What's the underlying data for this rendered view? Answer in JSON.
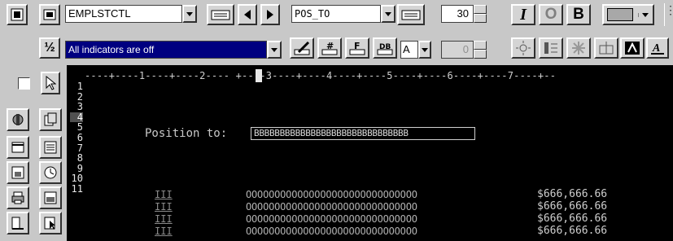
{
  "toolbar": {
    "record_format": {
      "value": "EMPLSTCTL"
    },
    "field_name": {
      "value": "POS_TO"
    },
    "length": {
      "value": "30"
    },
    "decimals": {
      "value": "0"
    },
    "indicators": {
      "value": "All indicators are off"
    },
    "format_a": {
      "value": "A"
    },
    "style_buttons": {
      "italic": "I",
      "outline": "O",
      "bold": "B"
    },
    "fraction_icon": "½"
  },
  "editor": {
    "ruler": "----+----1----+----2---- +----3----+----4----+----5----+----6----+----7----+--",
    "line_numbers": [
      "1",
      "2",
      "3",
      "4",
      "5",
      "6",
      "7",
      "8",
      "9",
      "10",
      "11"
    ],
    "active_line": "4",
    "position_label": "Position to:",
    "position_field": "BBBBBBBBBBBBBBBBBBBBBBBBBBBBBB",
    "rows": [
      {
        "ind": "III",
        "name": "OOOOOOOOOOOOOOOOOOOOOOOOOOOOOO",
        "amount": "$666,666.66"
      },
      {
        "ind": "III",
        "name": "OOOOOOOOOOOOOOOOOOOOOOOOOOOOOO",
        "amount": "$666,666.66"
      },
      {
        "ind": "III",
        "name": "OOOOOOOOOOOOOOOOOOOOOOOOOOOOOO",
        "amount": "$666,666.66"
      },
      {
        "ind": "III",
        "name": "OOOOOOOOOOOOOOOOOOOOOOOOOOOOOO",
        "amount": "$666,666.66"
      }
    ]
  },
  "colors": {
    "editor_bg": "#000000",
    "selection": "#000080",
    "chrome": "#c8c8c8"
  }
}
